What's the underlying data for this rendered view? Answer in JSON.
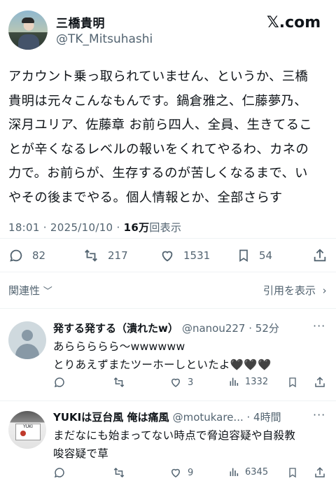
{
  "tweet": {
    "author_name": "三橋貴明",
    "author_handle": "@TK_Mitsuhashi",
    "site_logo": "𝕏.com",
    "text": "アカウント乗っ取られていません、というか、三橋\n貴明は元々こんなもんです。鍋倉雅之、仁藤夢乃、\n深月ユリア、佐藤章 お前ら四人、全員、生きてるこ\nとが辛くなるレベルの報いをくれてやるわ、カネの\n力で。お前らが、生存するのが苦しくなるまで、い\nやその後までやる。個人情報とか、全部さらす",
    "timestamp": "18:01 · 2025/10/10 · ",
    "views_count": "16万",
    "views_label": "回表示",
    "replies": "82",
    "retweets": "217",
    "likes": "1531",
    "bookmarks": "54"
  },
  "related_label": "関連性",
  "quotes_label": "引用を表示",
  "replies": [
    {
      "name": "発する発する（潰れたw）",
      "handle": "@nanou227 · 52分",
      "text": "あららららら〜wwwwww\nとりあえずまたツーホーしといたよ🖤🖤🖤",
      "replies": "",
      "retweets": "",
      "likes": "3",
      "views": "1332"
    },
    {
      "name": "YUKIは豆台風 俺は痛風",
      "handle": "@motukare... · 4時間",
      "text": "まだなにも始まってない時点で脅迫容疑や自殺教\n唆容疑で草",
      "replies": "",
      "retweets": "",
      "likes": "9",
      "views": "6345"
    }
  ],
  "icons": {
    "reply": "reply-icon",
    "retweet": "retweet-icon",
    "like": "heart-icon",
    "bookmark": "bookmark-icon",
    "share": "share-icon",
    "views": "views-icon"
  },
  "colors": {
    "text": "#0f1419",
    "secondary": "#536471",
    "divider": "#eff3f4"
  }
}
